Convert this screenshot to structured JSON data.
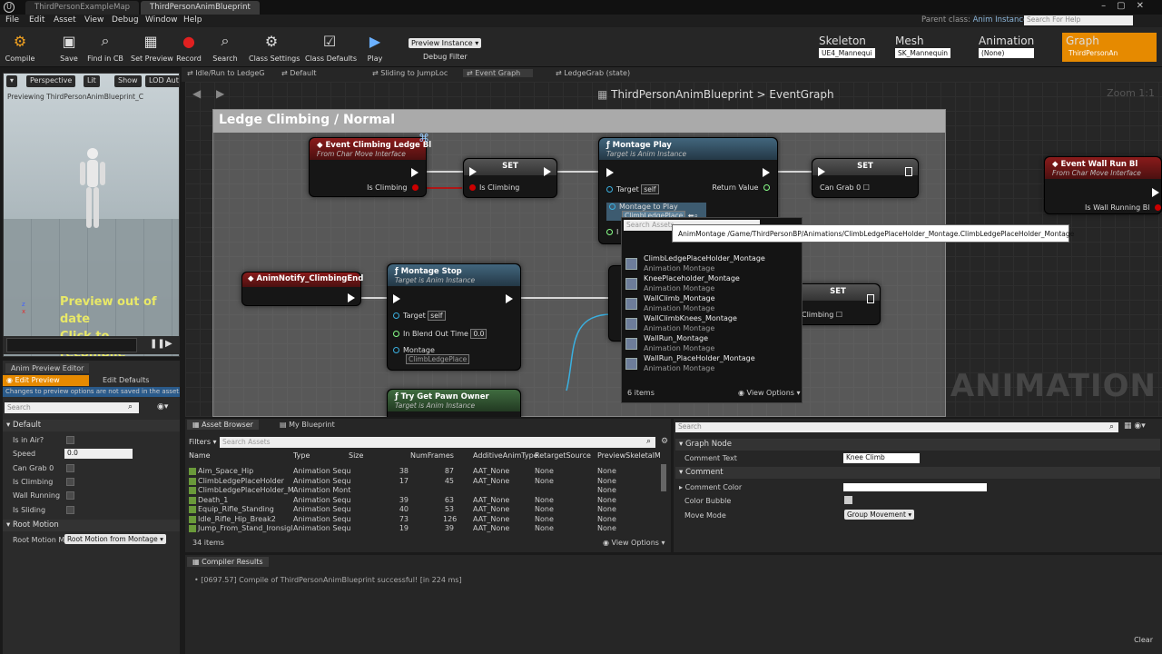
{
  "doc_tabs": [
    "ThirdPersonExampleMap",
    "ThirdPersonAnimBlueprint"
  ],
  "menu": [
    "File",
    "Edit",
    "Asset",
    "View",
    "Debug",
    "Window",
    "Help"
  ],
  "parent_class": {
    "label": "Parent class:",
    "value": "Anim Instance"
  },
  "help_search": "Search For Help",
  "toolbar": {
    "compile": "Compile",
    "save": "Save",
    "find": "Find in CB",
    "preview": "Set Preview",
    "search": "Search",
    "class_settings": "Class Settings",
    "class_defaults": "Class Defaults",
    "record": "Record",
    "play": "Play",
    "preview_instance": "Preview Instance",
    "debug_filter": "Debug Filter"
  },
  "modes": {
    "skeleton": "Skeleton",
    "skeleton_val": "UE4_Mannequi",
    "mesh": "Mesh",
    "mesh_val": "SK_Mannequin",
    "animation": "Animation",
    "animation_val": "(None)",
    "graph": "Graph",
    "graph_val": "ThirdPersonAn"
  },
  "viewport": {
    "perspective": "Perspective",
    "lit": "Lit",
    "show": "Show",
    "lod": "LOD Auto",
    "previewing": "Previewing ThirdPersonAnimBlueprint_C",
    "out_of_date": "Preview out of date",
    "click": "Click to recompile",
    "z": "z",
    "x": "x"
  },
  "anim_preview": {
    "title": "Anim Preview Editor",
    "edit_preview": "Edit Preview",
    "edit_defaults": "Edit Defaults",
    "notice": "Changes to preview options are not saved in the asset.",
    "search": "Search",
    "default": "Default",
    "props": [
      {
        "name": "Is in Air?"
      },
      {
        "name": "Speed",
        "value": "0.0"
      },
      {
        "name": "Can Grab 0"
      },
      {
        "name": "Is Climbing"
      },
      {
        "name": "Wall Running"
      },
      {
        "name": "Is Sliding"
      }
    ],
    "root_motion": "Root Motion",
    "root_motion_mode": "Root Motion Mc",
    "root_motion_val": "Root Motion from Montage"
  },
  "graph_tabs": [
    "Idle/Run to LedgeG",
    "Default",
    "Sliding to JumpLoc",
    "Event Graph",
    "LedgeGrab (state)"
  ],
  "breadcrumb": {
    "bp": "ThirdPersonAnimBlueprint",
    "sep": ">",
    "graph": "EventGraph"
  },
  "zoom": "Zoom 1:1",
  "watermark": "ANIMATION",
  "comment_title": "Ledge Climbing / Normal",
  "nodes": {
    "ev_climb": {
      "title": "Event Climbing Ledge Bl",
      "sub": "From Char Move Interface",
      "pin": "Is Climbing"
    },
    "set1": {
      "title": "SET",
      "pin": "Is Climbing"
    },
    "montage_play": {
      "title": "Montage Play",
      "sub": "Target is Anim Instance",
      "target": "Target",
      "self": "self",
      "ret": "Return Value",
      "mtp": "Montage to Play",
      "mtp_val": "ClimbLedgePlace",
      "i": "I"
    },
    "set2": {
      "title": "SET",
      "pin": "Can Grab 0"
    },
    "ev_wall": {
      "title": "Event Wall Run Bl",
      "sub": "From Char Move Interface",
      "pin": "Is Wall Running Bl"
    },
    "notify": {
      "title": "AnimNotify_ClimbingEnd"
    },
    "montage_stop": {
      "title": "Montage Stop",
      "sub": "Target is Anim Instance",
      "target": "Target",
      "self": "self",
      "blend": "In Blend Out Time",
      "blend_val": "0.0",
      "montage": "Montage",
      "montage_val": "ClimbLedgePlace"
    },
    "set3": {
      "title": "SET",
      "pin": "Climbing"
    },
    "pawn": {
      "title": "Try Get Pawn Owner",
      "sub": "Target is Anim Instance"
    }
  },
  "tooltip": "AnimMontage /Game/ThirdPersonBP/Animations/ClimbLedgePlaceHolder_Montage.ClimbLedgePlaceHolder_Montage",
  "dropdown": {
    "search": "Search Assets",
    "items": [
      {
        "name": "ClimbLedgePlaceHolder_Montage",
        "type": "Animation Montage"
      },
      {
        "name": "KneePlaceholder_Montage",
        "type": "Animation Montage"
      },
      {
        "name": "WallClimb_Montage",
        "type": "Animation Montage"
      },
      {
        "name": "WallClimbKnees_Montage",
        "type": "Animation Montage"
      },
      {
        "name": "WallRun_Montage",
        "type": "Animation Montage"
      },
      {
        "name": "WallRun_PlaceHolder_Montage",
        "type": "Animation Montage"
      }
    ],
    "count": "6 items",
    "view_options": "View Options"
  },
  "asset_browser": {
    "tab": "Asset Browser",
    "tab2": "My Blueprint",
    "filters": "Filters",
    "search": "Search Assets",
    "cols": [
      "Name",
      "Type",
      "Size",
      "NumFrames",
      "AdditiveAnimType",
      "RetargetSource",
      "PreviewSkeletalM"
    ],
    "rows": [
      [
        "Aim_Space_Hip",
        "Animation Sequ",
        "38",
        "87",
        "AAT_None",
        "None",
        "None"
      ],
      [
        "ClimbLedgePlaceHolder",
        "Animation Sequ",
        "17",
        "45",
        "AAT_None",
        "None",
        "None"
      ],
      [
        "ClimbLedgePlaceHolder_M",
        "Animation Mont",
        "",
        "",
        "",
        "",
        "None"
      ],
      [
        "Death_1",
        "Animation Sequ",
        "39",
        "63",
        "AAT_None",
        "None",
        "None"
      ],
      [
        "Equip_Rifle_Standing",
        "Animation Sequ",
        "40",
        "53",
        "AAT_None",
        "None",
        "None"
      ],
      [
        "Idle_Rifle_Hip_Break2",
        "Animation Sequ",
        "73",
        "126",
        "AAT_None",
        "None",
        "None"
      ],
      [
        "Jump_From_Stand_Ironsigl",
        "Animation Sequ",
        "19",
        "39",
        "AAT_None",
        "None",
        "None"
      ]
    ],
    "count": "34 items",
    "view_options": "View Options"
  },
  "details": {
    "search": "Search",
    "graph_node": "Graph Node",
    "comment_text": "Comment Text",
    "comment_val": "Knee Climb",
    "comment": "Comment",
    "color": "Comment Color",
    "bubble": "Color Bubble",
    "move": "Move Mode",
    "move_val": "Group Movement"
  },
  "compiler": {
    "tab": "Compiler Results",
    "msg": "[0697.57] Compile of ThirdPersonAnimBlueprint successful! [in 224 ms]",
    "clear": "Clear"
  }
}
